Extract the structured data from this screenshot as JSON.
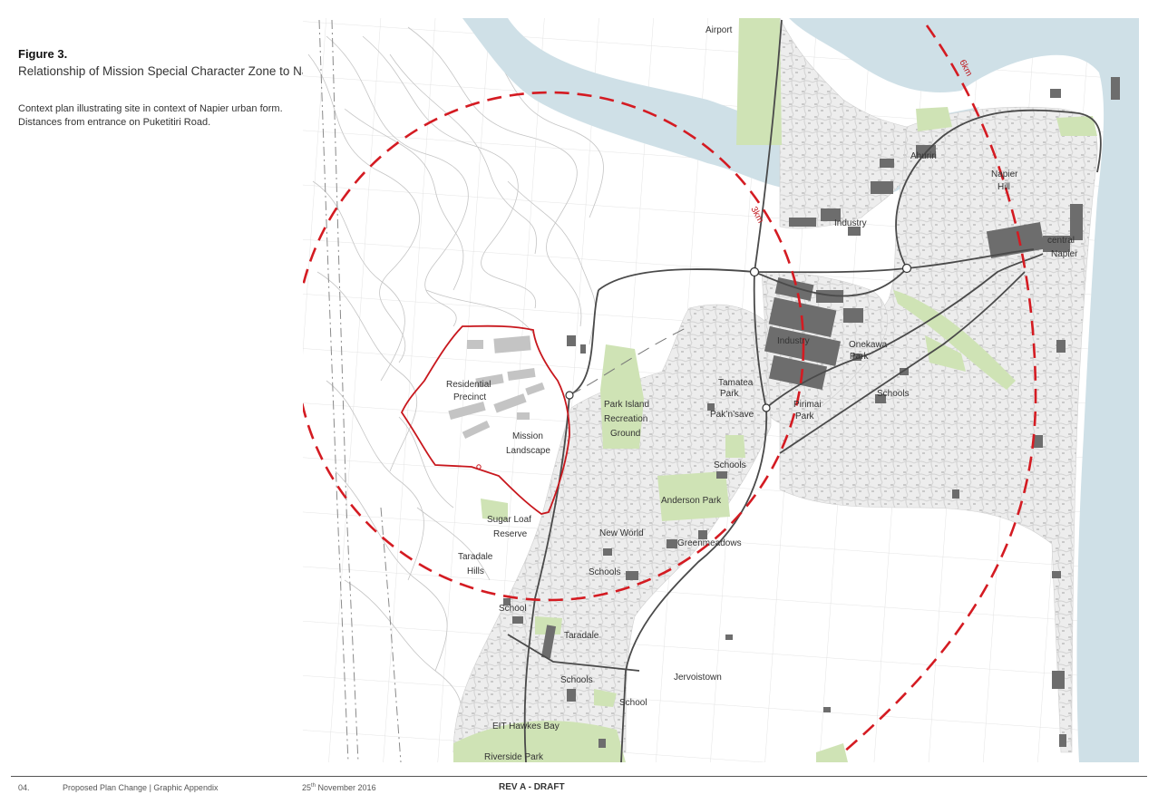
{
  "figure": {
    "number": "Figure 3.",
    "title": "Relationship of Mission Special Character Zone to Napier’s urban form",
    "description": "Context plan illustrating site in context of Napier urban form. Distances from entrance on Puketitiri Road."
  },
  "map": {
    "colors": {
      "sea": "#cfe0e7",
      "green_space": "#cfe3b5",
      "urban": "#e9e9e9",
      "building": "#6d6d6d",
      "road": "#4a4a4a",
      "site_boundary": "#c8171d",
      "distance_ring": "#d41b22",
      "contour": "#bdbdbd",
      "railway": "#888888"
    },
    "rings": [
      {
        "id": "ring-3km",
        "label": "3km"
      },
      {
        "id": "ring-6km",
        "label": "6km"
      }
    ],
    "labels": [
      {
        "id": "airport",
        "text": "Airport"
      },
      {
        "id": "ahuriri",
        "text": "Ahuriri"
      },
      {
        "id": "napier-hill-1",
        "text": "Napier"
      },
      {
        "id": "napier-hill-2",
        "text": "Hill"
      },
      {
        "id": "industry-north",
        "text": "Industry"
      },
      {
        "id": "central-napier-1",
        "text": "central"
      },
      {
        "id": "central-napier-2",
        "text": "Napier"
      },
      {
        "id": "industry-central",
        "text": "Industry"
      },
      {
        "id": "onekawa-park-1",
        "text": "Onekawa"
      },
      {
        "id": "onekawa-park-2",
        "text": "Park"
      },
      {
        "id": "residential-precinct-1",
        "text": "Residential"
      },
      {
        "id": "residential-precinct-2",
        "text": "Precinct"
      },
      {
        "id": "tamatea-park-1",
        "text": "Tamatea"
      },
      {
        "id": "tamatea-park-2",
        "text": "Park"
      },
      {
        "id": "schools-east",
        "text": "Schools"
      },
      {
        "id": "park-island-1",
        "text": "Park Island"
      },
      {
        "id": "park-island-2",
        "text": "Recreation"
      },
      {
        "id": "park-island-3",
        "text": "Ground"
      },
      {
        "id": "pak-n-save",
        "text": "Pak’n’save"
      },
      {
        "id": "pirimai-park-1",
        "text": "Pirimai"
      },
      {
        "id": "pirimai-park-2",
        "text": "Park"
      },
      {
        "id": "mission-landscape-1",
        "text": "Mission"
      },
      {
        "id": "mission-landscape-2",
        "text": "Landscape"
      },
      {
        "id": "schools-tamatea",
        "text": "Schools"
      },
      {
        "id": "anderson-park",
        "text": "Anderson Park"
      },
      {
        "id": "sugar-loaf-1",
        "text": "Sugar Loaf"
      },
      {
        "id": "sugar-loaf-2",
        "text": "Reserve"
      },
      {
        "id": "new-world",
        "text": "New World"
      },
      {
        "id": "greenmeadows",
        "text": "Greenmeadows"
      },
      {
        "id": "taradale-hills-1",
        "text": "Taradale"
      },
      {
        "id": "taradale-hills-2",
        "text": "Hills"
      },
      {
        "id": "schools-greenmeadows",
        "text": "Schools"
      },
      {
        "id": "school-taradale-west",
        "text": "School"
      },
      {
        "id": "taradale",
        "text": "Taradale"
      },
      {
        "id": "jervoistown",
        "text": "Jervoistown"
      },
      {
        "id": "schools-taradale",
        "text": "Schools"
      },
      {
        "id": "school-taradale-south",
        "text": "School"
      },
      {
        "id": "eit-hawkes-bay",
        "text": "EIT Hawkes Bay"
      },
      {
        "id": "riverside-park",
        "text": "Riverside Park"
      }
    ]
  },
  "footer": {
    "page": "04.",
    "document": "Proposed Plan Change  |  Graphic Appendix",
    "date_day": "25",
    "date_suffix": "th",
    "date_rest": " November 2016",
    "revision": "REV A - DRAFT"
  }
}
